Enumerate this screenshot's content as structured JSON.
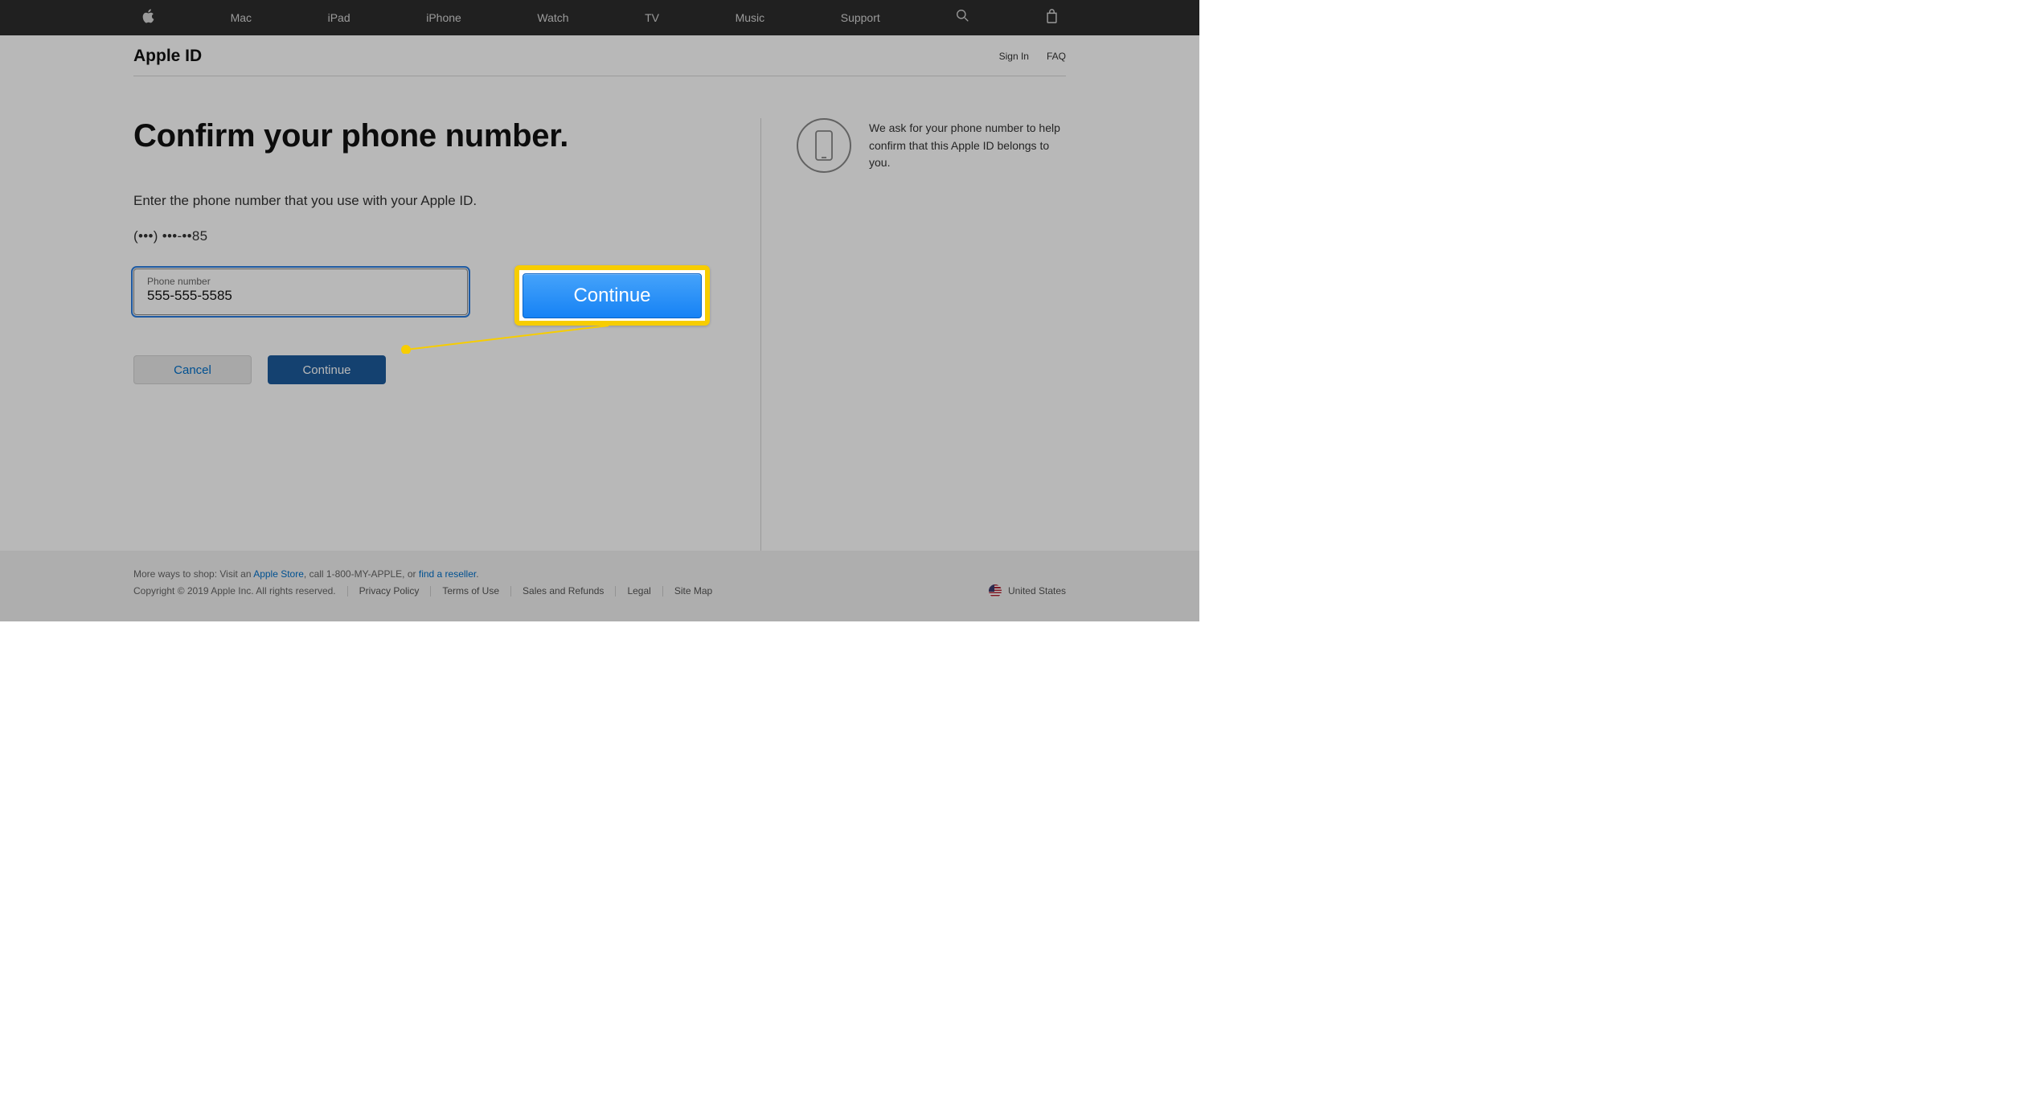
{
  "nav": {
    "items": [
      "Mac",
      "iPad",
      "iPhone",
      "Watch",
      "TV",
      "Music",
      "Support"
    ]
  },
  "subheader": {
    "title": "Apple ID",
    "links": [
      "Sign In",
      "FAQ"
    ]
  },
  "page": {
    "heading": "Confirm your phone number.",
    "instruction": "Enter the phone number that you use with your Apple ID.",
    "masked": "(•••) •••-••85",
    "input_label": "Phone number",
    "input_value": "555-555-5585",
    "cancel_label": "Cancel",
    "continue_label": "Continue",
    "aside_text": "We ask for your phone number to help confirm that this Apple ID belongs to you."
  },
  "callout": {
    "button_label": "Continue"
  },
  "footer": {
    "shop_prefix": "More ways to shop: Visit an ",
    "store_link": "Apple Store",
    "shop_mid": ", call 1-800-MY-APPLE, or ",
    "reseller_link": "find a reseller",
    "shop_suffix": ".",
    "copyright": "Copyright © 2019 Apple Inc. All rights reserved.",
    "legal_links": [
      "Privacy Policy",
      "Terms of Use",
      "Sales and Refunds",
      "Legal",
      "Site Map"
    ],
    "locale": "United States"
  }
}
